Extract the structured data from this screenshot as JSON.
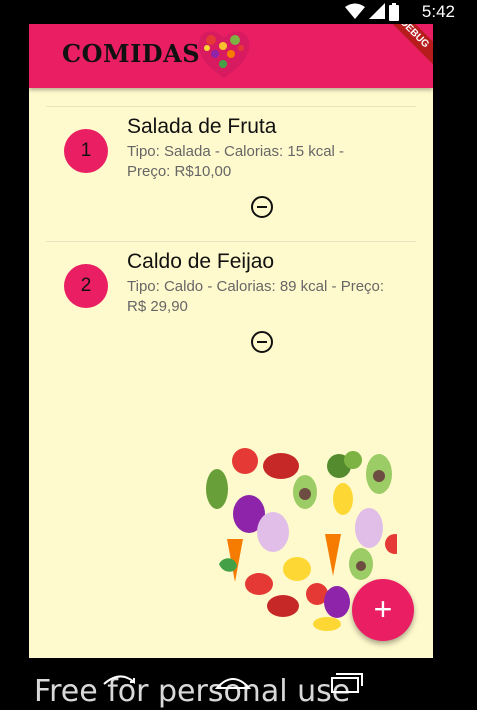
{
  "status_bar": {
    "time": "5:42"
  },
  "app_bar": {
    "title": "COMIDAS",
    "debug_label": "DEBUG"
  },
  "foods": [
    {
      "index": "1",
      "name": "Salada de Fruta",
      "details": " Tipo: Salada - Calorias: 15 kcal - Preço: R$10,00"
    },
    {
      "index": "2",
      "name": "Caldo de Feijao",
      "details": " Tipo: Caldo - Calorias: 89 kcal - Preço: R$ 29,90"
    }
  ],
  "fab": {
    "label": "+"
  },
  "watermark": "Free for personal use",
  "colors": {
    "primary": "#E91E63",
    "background": "#FFFACD",
    "debug": "#B71C1C"
  }
}
